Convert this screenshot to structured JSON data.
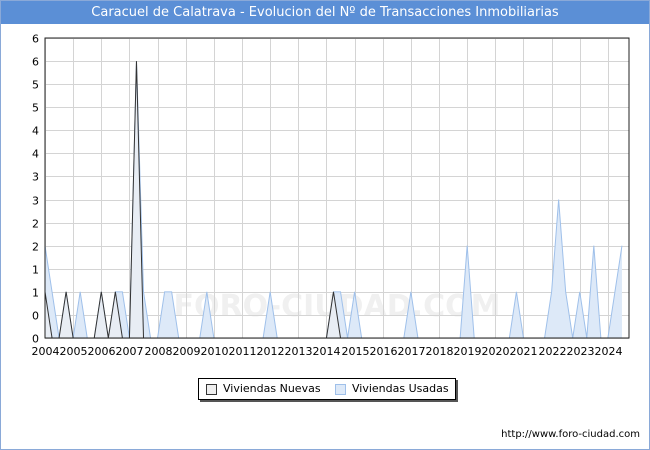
{
  "header": {
    "title": "Caracuel de Calatrava - Evolucion del Nº de Transacciones Inmobiliarias"
  },
  "footer": {
    "url": "http://www.foro-ciudad.com"
  },
  "watermark": "FORO-CIUDAD.COM",
  "legend": {
    "items": [
      {
        "label": "Viviendas Nuevas",
        "color": "#eeeeee",
        "stroke": "#333333"
      },
      {
        "label": "Viviendas Usadas",
        "color": "#dde9f8",
        "stroke": "#9fc0ea"
      }
    ]
  },
  "chart_data": {
    "type": "area",
    "title": "Caracuel de Calatrava - Evolucion del Nº de Transacciones Inmobiliarias",
    "xlabel": "",
    "ylabel": "",
    "x_range": [
      2004,
      2024.75
    ],
    "xlim": [
      2004,
      2024.75
    ],
    "ylim": [
      0,
      6.5
    ],
    "y_tick_values": [
      0,
      0.5,
      1,
      1.5,
      2,
      2.5,
      3,
      3.5,
      4,
      4.5,
      5,
      5.5,
      6,
      6.5
    ],
    "y_tick_labels": [
      "0",
      "0",
      "1",
      "1",
      "2",
      "2",
      "3",
      "3",
      "4",
      "4",
      "5",
      "5",
      "6",
      "6"
    ],
    "x_tick_labels": [
      "2004",
      "2005",
      "2006",
      "2007",
      "2008",
      "2009",
      "2010",
      "2011",
      "2012",
      "2013",
      "2014",
      "2015",
      "2016",
      "2017",
      "2018",
      "2019",
      "2020",
      "2021",
      "2022",
      "2023",
      "2024"
    ],
    "x_tick_values": [
      2004,
      2005,
      2006,
      2007,
      2008,
      2009,
      2010,
      2011,
      2012,
      2013,
      2014,
      2015,
      2016,
      2017,
      2018,
      2019,
      2020,
      2021,
      2022,
      2023,
      2024
    ],
    "grid": true,
    "legend_position": "bottom-center",
    "series": [
      {
        "name": "Viviendas Nuevas",
        "color": "#f0f0f0",
        "stroke": "#333333",
        "points": [
          [
            2004.0,
            1
          ],
          [
            2004.25,
            0
          ],
          [
            2004.5,
            0
          ],
          [
            2004.75,
            1
          ],
          [
            2005.0,
            0
          ],
          [
            2005.25,
            0
          ],
          [
            2005.5,
            0
          ],
          [
            2005.75,
            0
          ],
          [
            2006.0,
            1
          ],
          [
            2006.25,
            0
          ],
          [
            2006.5,
            1
          ],
          [
            2006.75,
            0
          ],
          [
            2007.0,
            0
          ],
          [
            2007.25,
            6
          ],
          [
            2007.5,
            0
          ],
          [
            2007.75,
            0
          ],
          [
            2014.0,
            0
          ],
          [
            2014.25,
            1
          ],
          [
            2014.5,
            0
          ]
        ]
      },
      {
        "name": "Viviendas Usadas",
        "color": "#dde9f8",
        "stroke": "#9fc0ea",
        "points": [
          [
            2004.0,
            2
          ],
          [
            2004.25,
            1
          ],
          [
            2004.5,
            0
          ],
          [
            2004.75,
            1
          ],
          [
            2005.0,
            0
          ],
          [
            2005.25,
            1
          ],
          [
            2005.5,
            0
          ],
          [
            2005.75,
            0
          ],
          [
            2006.0,
            1
          ],
          [
            2006.25,
            0
          ],
          [
            2006.5,
            1
          ],
          [
            2006.75,
            1
          ],
          [
            2007.0,
            0
          ],
          [
            2007.25,
            6
          ],
          [
            2007.5,
            1
          ],
          [
            2007.75,
            0
          ],
          [
            2008.0,
            0
          ],
          [
            2008.25,
            1
          ],
          [
            2008.5,
            1
          ],
          [
            2008.75,
            0
          ],
          [
            2009.5,
            0
          ],
          [
            2009.75,
            1
          ],
          [
            2010.0,
            0
          ],
          [
            2011.75,
            0
          ],
          [
            2012.0,
            1
          ],
          [
            2012.25,
            0
          ],
          [
            2013.5,
            0
          ],
          [
            2014.0,
            0
          ],
          [
            2014.25,
            1
          ],
          [
            2014.5,
            1
          ],
          [
            2014.75,
            0
          ],
          [
            2015.0,
            1
          ],
          [
            2015.25,
            0
          ],
          [
            2016.75,
            0
          ],
          [
            2017.0,
            1
          ],
          [
            2017.25,
            0
          ],
          [
            2018.75,
            0
          ],
          [
            2019.0,
            2
          ],
          [
            2019.25,
            0
          ],
          [
            2020.5,
            0
          ],
          [
            2020.75,
            1
          ],
          [
            2021.0,
            0
          ],
          [
            2021.75,
            0
          ],
          [
            2022.0,
            1
          ],
          [
            2022.25,
            3
          ],
          [
            2022.5,
            1
          ],
          [
            2022.75,
            0
          ],
          [
            2023.0,
            1
          ],
          [
            2023.25,
            0
          ],
          [
            2023.5,
            2
          ],
          [
            2023.75,
            0
          ],
          [
            2024.0,
            0
          ],
          [
            2024.25,
            1
          ],
          [
            2024.5,
            2
          ]
        ]
      }
    ]
  }
}
